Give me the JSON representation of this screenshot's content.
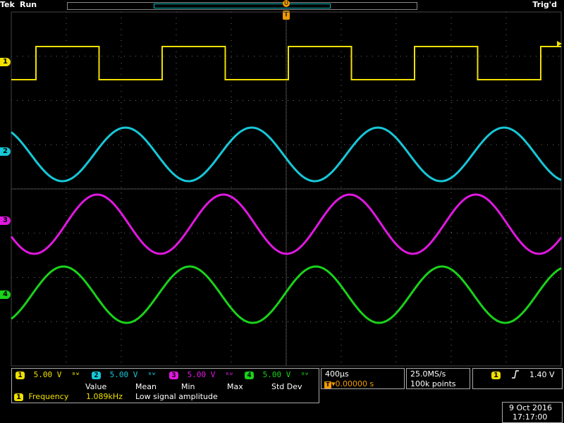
{
  "header": {
    "brand": "Tek",
    "state": "Run",
    "trigger_status": "Trig'd"
  },
  "colors": {
    "ch1": "#f0e000",
    "ch2": "#16c8d8",
    "ch3": "#e018e0",
    "ch4": "#1ad21a",
    "grid": "#707070"
  },
  "markers": {
    "ch1": "1",
    "ch2": "2",
    "ch3": "3",
    "ch4": "4",
    "trigger_pos": "T",
    "trigger_time": "U"
  },
  "channels": [
    {
      "num": "1",
      "scale": "5.00 V",
      "coupling": "bw"
    },
    {
      "num": "2",
      "scale": "5.00 V",
      "coupling": "bw"
    },
    {
      "num": "3",
      "scale": "5.00 V",
      "coupling": "bw"
    },
    {
      "num": "4",
      "scale": "5.00 V",
      "coupling": "bw"
    }
  ],
  "horizontal": {
    "timebase": "400µs",
    "delay": "▾0.00000 s"
  },
  "acquisition": {
    "rate": "25.0MS/s",
    "record": "100k points"
  },
  "trigger": {
    "source": "1",
    "slope_icon": "rising-edge-icon",
    "level": "1.40 V"
  },
  "measurement": {
    "headers": [
      "Value",
      "Mean",
      "Min",
      "Max",
      "Std Dev"
    ],
    "channel": "1",
    "name": "Frequency",
    "value": "1.089kHz",
    "note": "Low signal amplitude"
  },
  "datetime": {
    "date": "9 Oct  2016",
    "time": "17:17:00"
  }
}
